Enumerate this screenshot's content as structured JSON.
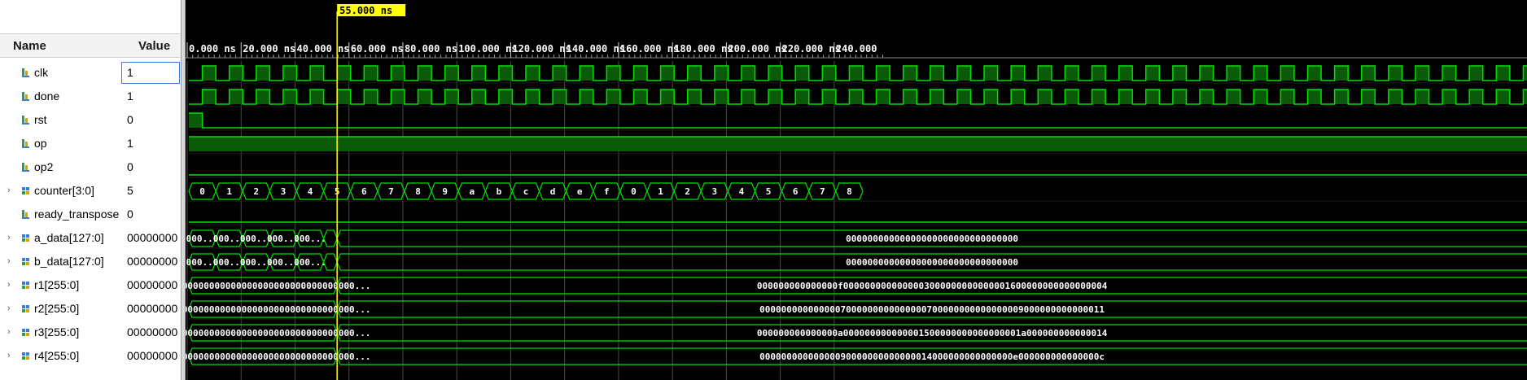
{
  "panel": {
    "name_header": "Name",
    "value_header": "Value"
  },
  "cursor": {
    "label": "55.000 ns",
    "time_ns": 55
  },
  "timeline": {
    "start_ns": 0,
    "tick_labels": [
      "0.000 ns",
      "20.000 ns",
      "40.000 ns",
      "60.000 ns",
      "80.000 ns",
      "100.000 ns",
      "120.000 ns",
      "140.000 ns",
      "160.000 ns",
      "180.000 ns",
      "200.000 ns",
      "220.000 ns",
      "240.000"
    ]
  },
  "colors": {
    "wave": "#00e000",
    "fill": "#0a5a0a",
    "cursor": "#ffff00",
    "cursor_label_bg": "#ffff00",
    "background": "#000000",
    "grid": "#4a4a4a",
    "tick_text": "#ffffff",
    "bus_text": "#ffffff"
  },
  "signals": [
    {
      "name": "clk",
      "value": "1",
      "kind": "bit",
      "expandable": false,
      "icon": "signal-bit-icon",
      "selected": true
    },
    {
      "name": "done",
      "value": "1",
      "kind": "bit",
      "expandable": false,
      "icon": "signal-bit-icon"
    },
    {
      "name": "rst",
      "value": "0",
      "kind": "bit",
      "expandable": false,
      "icon": "signal-bit-icon"
    },
    {
      "name": "op",
      "value": "1",
      "kind": "bit",
      "expandable": false,
      "icon": "signal-bit-icon"
    },
    {
      "name": "op2",
      "value": "0",
      "kind": "bit",
      "expandable": false,
      "icon": "signal-bit-icon"
    },
    {
      "name": "counter[3:0]",
      "value": "5",
      "kind": "bus",
      "expandable": true,
      "icon": "signal-bus-icon"
    },
    {
      "name": "ready_transpose",
      "value": "0",
      "kind": "bit",
      "expandable": false,
      "icon": "signal-bit-icon"
    },
    {
      "name": "a_data[127:0]",
      "value": "00000000",
      "kind": "bus",
      "expandable": true,
      "icon": "signal-bus-icon"
    },
    {
      "name": "b_data[127:0]",
      "value": "00000000",
      "kind": "bus",
      "expandable": true,
      "icon": "signal-bus-icon"
    },
    {
      "name": "r1[255:0]",
      "value": "00000000",
      "kind": "bus",
      "expandable": true,
      "icon": "signal-bus-icon"
    },
    {
      "name": "r2[255:0]",
      "value": "00000000",
      "kind": "bus",
      "expandable": true,
      "icon": "signal-bus-icon"
    },
    {
      "name": "r3[255:0]",
      "value": "00000000",
      "kind": "bus",
      "expandable": true,
      "icon": "signal-bus-icon"
    },
    {
      "name": "r4[255:0]",
      "value": "00000000",
      "kind": "bus",
      "expandable": true,
      "icon": "signal-bus-icon"
    }
  ],
  "waveforms": {
    "clk": {
      "type": "clock",
      "period_ns": 10,
      "high_first_ns": 5
    },
    "done": {
      "type": "clock",
      "period_ns": 10,
      "high_first_ns": 5
    },
    "rst": {
      "type": "transitions",
      "initial": 1,
      "transitions_ns": [
        5
      ]
    },
    "op": {
      "type": "constant",
      "level": 1
    },
    "op2": {
      "type": "constant",
      "level": 0
    },
    "counter[3:0]": {
      "type": "bus",
      "segments": [
        {
          "from_ns": 0,
          "to_ns": 7.5,
          "label": "0"
        },
        {
          "from_ns": 7.5,
          "to_ns": 12.5,
          "label": ""
        },
        {
          "from_ns": 0,
          "to_ns": 5,
          "label": ""
        }
      ],
      "labels": [
        "0",
        "1",
        "2",
        "3",
        "4",
        "5",
        "6",
        "7",
        "8",
        "9",
        "a",
        "b",
        "c",
        "d",
        "e",
        "f",
        "0",
        "1",
        "2",
        "3",
        "4",
        "5",
        "6",
        "7",
        "8"
      ],
      "step_ns": 10,
      "offset_ns": 0
    },
    "ready_transpose": {
      "type": "constant",
      "level": 0
    },
    "a_data[127:0]": {
      "type": "bus_short",
      "short_labels": [
        "000...",
        "000...",
        "000...",
        "000...",
        "000..."
      ],
      "step_ns": 10,
      "tail_label": "00000000000000000000000000000000",
      "tail_from_ns": 55
    },
    "b_data[127:0]": {
      "type": "bus_short",
      "short_labels": [
        "000...",
        "000...",
        "000...",
        "000...",
        "000..."
      ],
      "step_ns": 10,
      "tail_label": "00000000000000000000000000000000",
      "tail_from_ns": 55
    },
    "r1[255:0]": {
      "type": "bus_long",
      "head_label": "0000000000000000000000000000000000000...",
      "tail_label": "000000000000000f0000000000000003000000000000001600000000000000004",
      "change_ns": 55
    },
    "r2[255:0]": {
      "type": "bus_long",
      "head_label": "0000000000000000000000000000000000000...",
      "tail_label": "0000000000000007000000000000000700000000000000009000000000000011",
      "change_ns": 55
    },
    "r3[255:0]": {
      "type": "bus_long",
      "head_label": "0000000000000000000000000000000000000...",
      "tail_label": "000000000000000a000000000000001500000000000000001a000000000000014",
      "change_ns": 55
    },
    "r4[255:0]": {
      "type": "bus_long",
      "head_label": "0000000000000000000000000000000000000...",
      "tail_label": "00000000000000090000000000000014000000000000000e000000000000000c",
      "change_ns": 55
    }
  }
}
